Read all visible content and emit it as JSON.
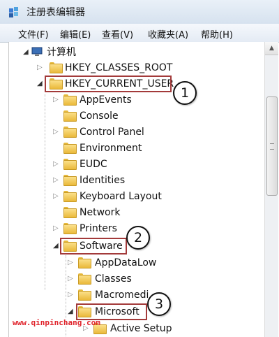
{
  "window": {
    "title": "注册表编辑器",
    "icon": "regedit-icon"
  },
  "menubar": {
    "items": [
      "文件(F)",
      "编辑(E)",
      "查看(V)",
      "收藏夹(A)",
      "帮助(H)"
    ]
  },
  "tree": {
    "root": "计算机",
    "level1": [
      "HKEY_CLASSES_ROOT",
      "HKEY_CURRENT_USER"
    ],
    "hkcu_children": [
      "AppEvents",
      "Console",
      "Control Panel",
      "Environment",
      "EUDC",
      "Identities",
      "Keyboard Layout",
      "Network",
      "Printers",
      "Software"
    ],
    "software_children": [
      "AppDataLow",
      "Classes",
      "Macromedi",
      "Microsoft"
    ],
    "microsoft_children": [
      "Active Setup"
    ]
  },
  "callouts": [
    "1",
    "2",
    "3"
  ],
  "watermark": "www.qinpinchang.com",
  "colors": {
    "highlight_box": "#a33a3a",
    "watermark": "#e0242c",
    "folder": "#eab93a"
  }
}
